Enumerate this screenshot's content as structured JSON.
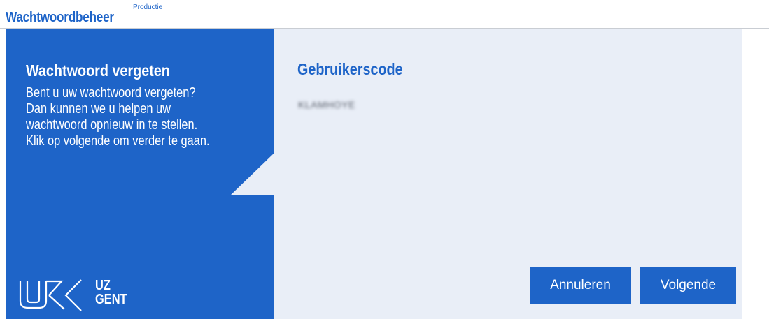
{
  "header": {
    "app_title": "Wachtwoordbeheer",
    "environment": "Productie"
  },
  "sidebar": {
    "title": "Wachtwoord vergeten",
    "lines": [
      "Bent u uw wachtwoord vergeten?",
      "Dan kunnen we u helpen uw",
      "wachtwoord opnieuw in te stellen.",
      "Klik op volgende om verder te gaan."
    ],
    "logo_text_1": "UZ",
    "logo_text_2": "GENT"
  },
  "form": {
    "user_code_label": "Gebruikerscode",
    "user_code_value": "KLAMHOYE"
  },
  "actions": {
    "cancel_label": "Annuleren",
    "next_label": "Volgende"
  },
  "colors": {
    "brand_blue": "#1e64c8",
    "panel_background": "#e9eef7"
  }
}
